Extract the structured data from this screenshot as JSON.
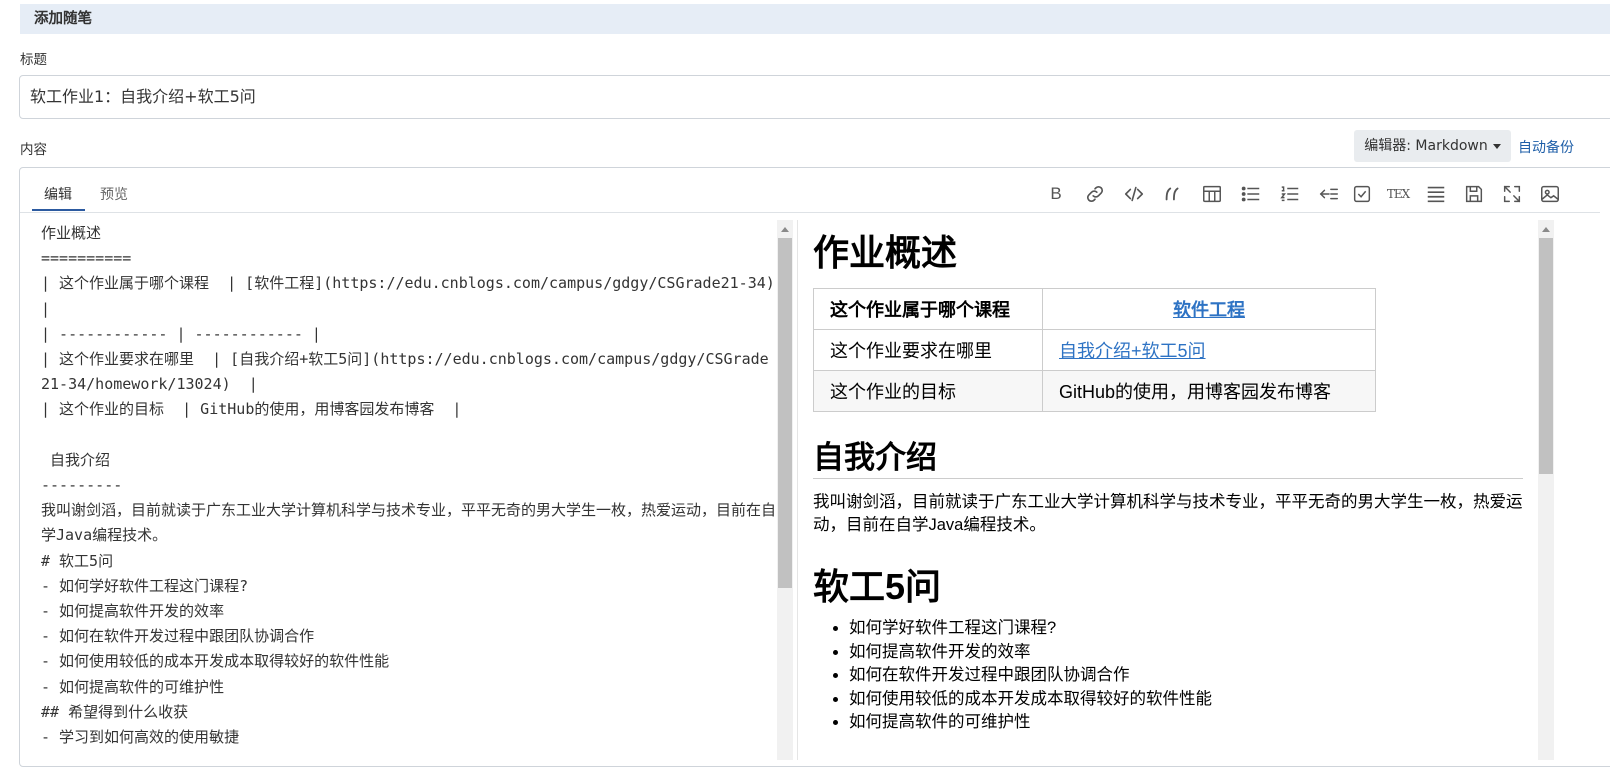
{
  "header": {
    "title": "添加随笔"
  },
  "title_field": {
    "label": "标题",
    "value": "软工作业1：自我介绍+软工5问"
  },
  "content_field": {
    "label": "内容",
    "editor_select": "编辑器: Markdown",
    "auto_backup": "自动备份"
  },
  "tabs": [
    {
      "label": "编辑",
      "active": true
    },
    {
      "label": "预览",
      "active": false
    }
  ],
  "toolbar": {
    "bold": "B",
    "tex": "TEX",
    "icons": [
      "bold-icon",
      "link-icon",
      "code-icon",
      "quote-icon",
      "table-icon",
      "unordered-list-icon",
      "ordered-list-icon",
      "outdent-icon",
      "checkbox-icon",
      "tex-icon",
      "align-icon",
      "save-icon",
      "fullscreen-icon",
      "image-icon"
    ]
  },
  "source_lines": [
    "作业概述",
    "==========",
    "| 这个作业属于哪个课程  | [软件工程](https://edu.cnblogs.com/campus/gdgy/CSGrade21-34)  |",
    "| ------------ | ------------ |",
    "| 这个作业要求在哪里  | [自我介绍+软工5问](https://edu.cnblogs.com/campus/gdgy/CSGrade21-34/homework/13024)  |",
    "| 这个作业的目标  | GitHub的使用，用博客园发布博客  |",
    "",
    " 自我介绍",
    "---------",
    "我叫谢剑滔，目前就读于广东工业大学计算机科学与技术专业，平平无奇的男大学生一枚，热爱运动，目前在自学Java编程技术。",
    "# 软工5问",
    "- 如何学好软件工程这门课程?",
    "- 如何提高软件开发的效率",
    "- 如何在软件开发过程中跟团队协调合作",
    "- 如何使用较低的成本开发成本取得较好的软件性能",
    "- 如何提高软件的可维护性",
    "## 希望得到什么收获",
    "- 学习到如何高效的使用敏捷"
  ],
  "preview": {
    "h1_overview": "作业概述",
    "table": {
      "header": {
        "left": "这个作业属于哪个课程",
        "right": "软件工程"
      },
      "rows": [
        {
          "left": "这个作业要求在哪里",
          "right": "自我介绍+软工5问"
        },
        {
          "left": "这个作业的目标",
          "right": "GitHub的使用，用博客园发布博客"
        }
      ]
    },
    "h2_intro": "自我介绍",
    "intro_text": "我叫谢剑滔，目前就读于广东工业大学计算机科学与技术专业，平平无奇的男大学生一枚，热爱运动，目前在自学Java编程技术。",
    "h1_five": "软工5问",
    "questions": [
      "如何学好软件工程这门课程?",
      "如何提高软件开发的效率",
      "如何在软件开发过程中跟团队协调合作",
      "如何使用较低的成本开发成本取得较好的软件性能",
      "如何提高软件的可维护性"
    ]
  }
}
